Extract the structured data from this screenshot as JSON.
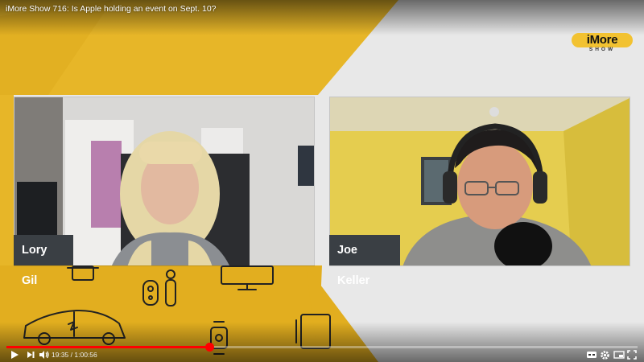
{
  "video": {
    "title": "iMore Show 716: Is Apple holding an event on Sept. 10?",
    "current_time": "19:35",
    "duration": "1:00:56",
    "time_separator": " / ",
    "progress_fraction": 0.321
  },
  "logo": {
    "main": "iMore",
    "sub": "SHOW"
  },
  "participants": [
    {
      "name": "Lory Gil"
    },
    {
      "name": "Joe Keller"
    }
  ],
  "controls": {
    "play_icon": "play-icon",
    "next_icon": "next-icon",
    "volume_icon": "volume-icon",
    "cc_icon": "captions-icon",
    "settings_icon": "gear-icon",
    "miniplayer_icon": "miniplayer-icon",
    "theater_icon": "theater-icon",
    "fullscreen_icon": "fullscreen-icon"
  },
  "colors": {
    "brand_yellow": "#e7b628",
    "progress_red": "#ff0000",
    "name_tag_bg": "#3a3f44"
  }
}
